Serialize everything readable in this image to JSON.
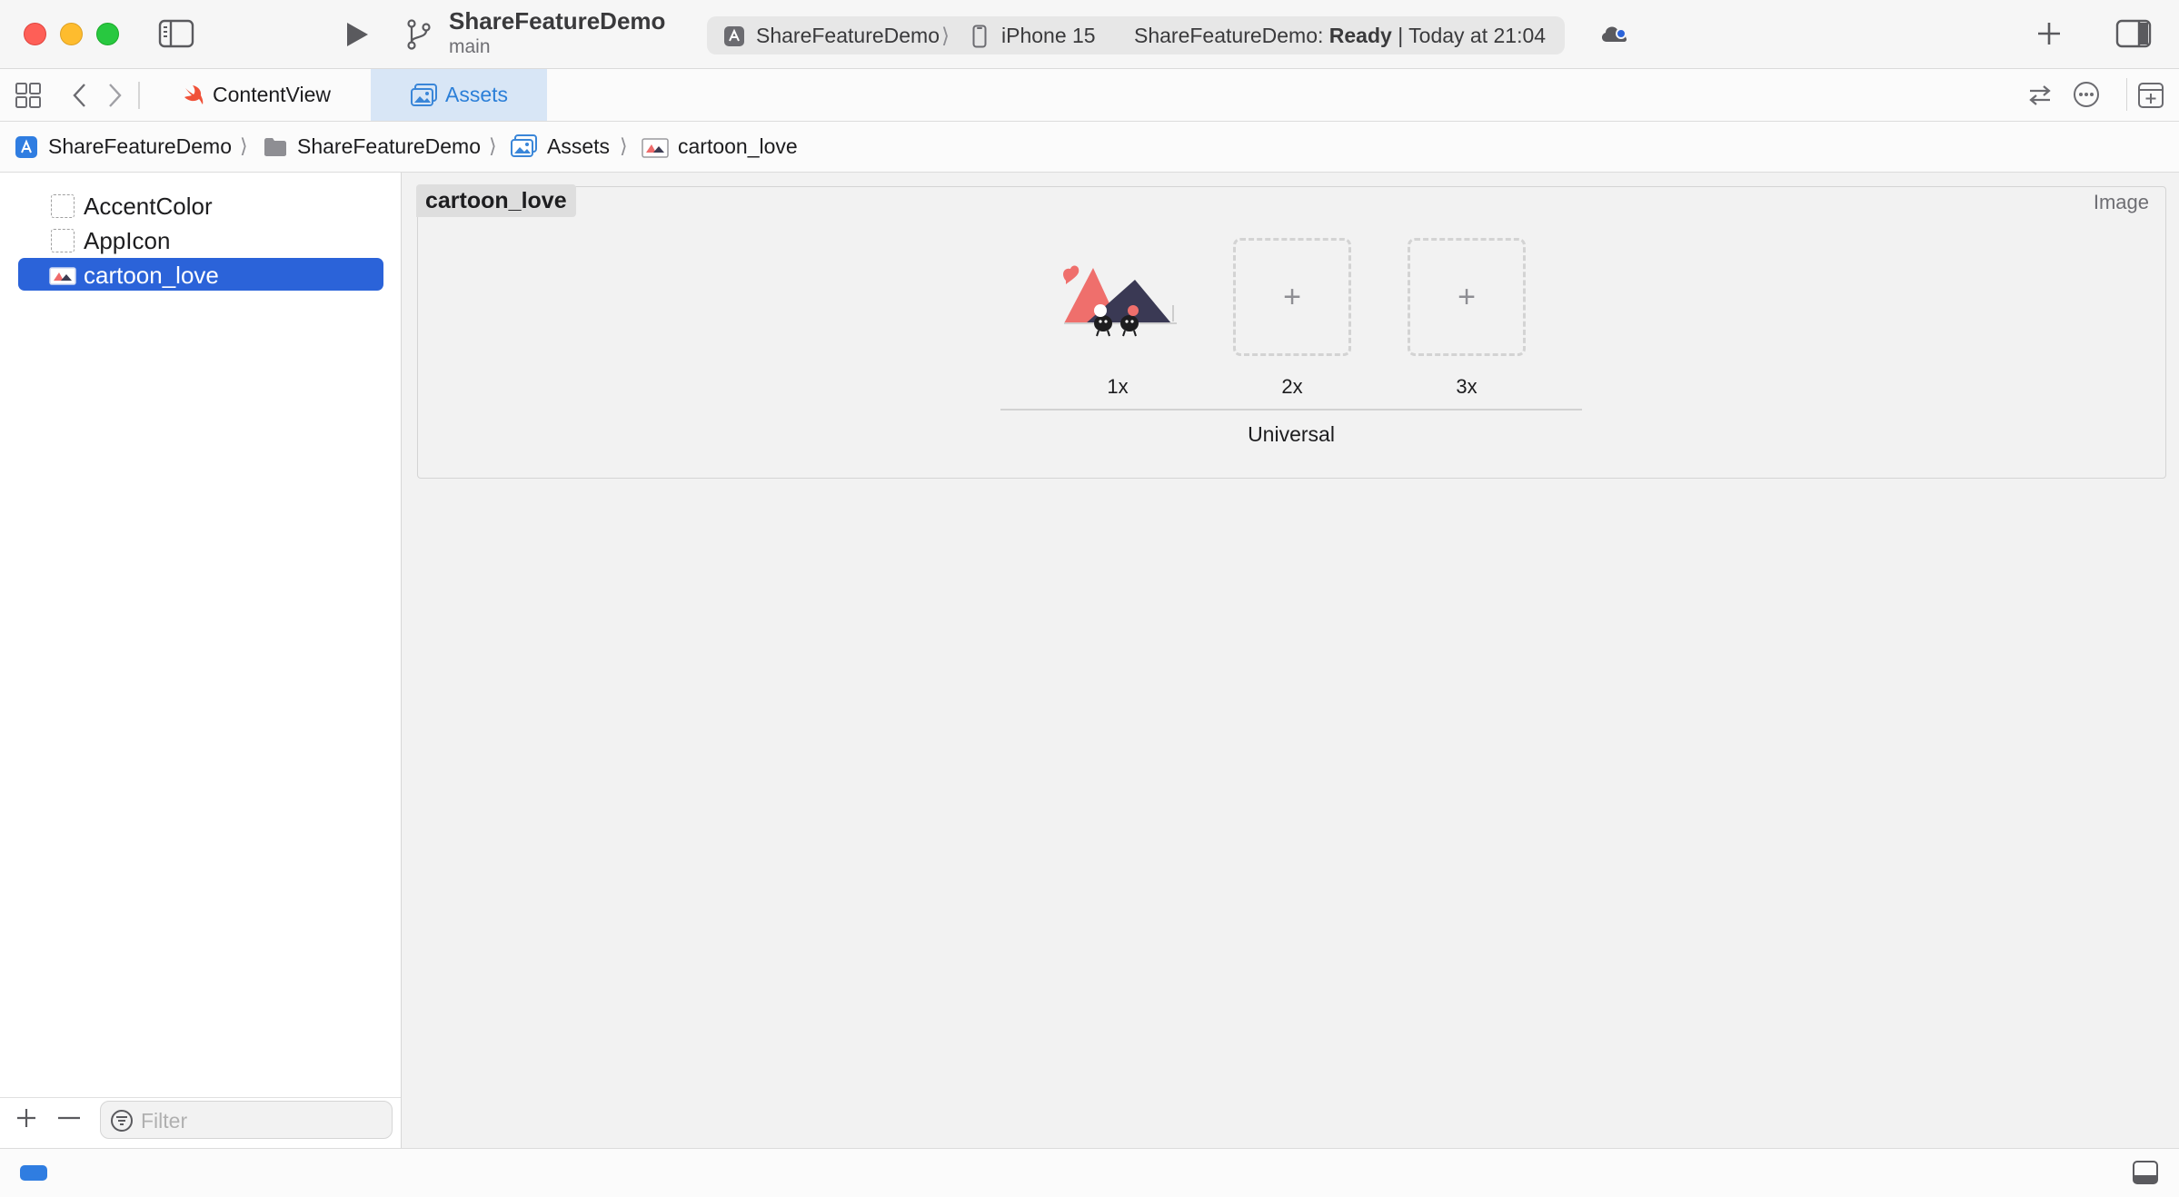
{
  "window": {
    "project_name": "ShareFeatureDemo",
    "branch": "main"
  },
  "activity": {
    "scheme": "ShareFeatureDemo",
    "device": "iPhone 15",
    "status_prefix": "ShareFeatureDemo:",
    "status_state": "Ready",
    "status_time": "| Today at 21:04"
  },
  "tabs": [
    {
      "label": "ContentView",
      "icon": "swift-icon",
      "active": false
    },
    {
      "label": "Assets",
      "icon": "asset-catalog-icon",
      "active": true
    }
  ],
  "breadcrumb": [
    {
      "label": "ShareFeatureDemo",
      "icon": "xcode-project-icon"
    },
    {
      "label": "ShareFeatureDemo",
      "icon": "folder-icon"
    },
    {
      "label": "Assets",
      "icon": "asset-catalog-icon"
    },
    {
      "label": "cartoon_love",
      "icon": "image-set-icon"
    }
  ],
  "navigator": {
    "items": [
      {
        "label": "AccentColor",
        "icon": "color-set-icon",
        "selected": false
      },
      {
        "label": "AppIcon",
        "icon": "app-icon-set-icon",
        "selected": false
      },
      {
        "label": "cartoon_love",
        "icon": "image-set-icon",
        "selected": true
      }
    ],
    "filter_placeholder": "Filter",
    "filter_value": ""
  },
  "editor": {
    "asset_name": "cartoon_love",
    "asset_kind": "Image",
    "slots": [
      {
        "scale": "1x",
        "filled": true
      },
      {
        "scale": "2x",
        "filled": false,
        "placeholder": "+"
      },
      {
        "scale": "3x",
        "filled": false,
        "placeholder": "+"
      }
    ],
    "idiom": "Universal"
  },
  "colors": {
    "accent": "#2b63d9",
    "selected_tab_bg": "#d8e6f6",
    "close": "#fe5f57",
    "minimize": "#febc2e",
    "zoom": "#28c840"
  }
}
